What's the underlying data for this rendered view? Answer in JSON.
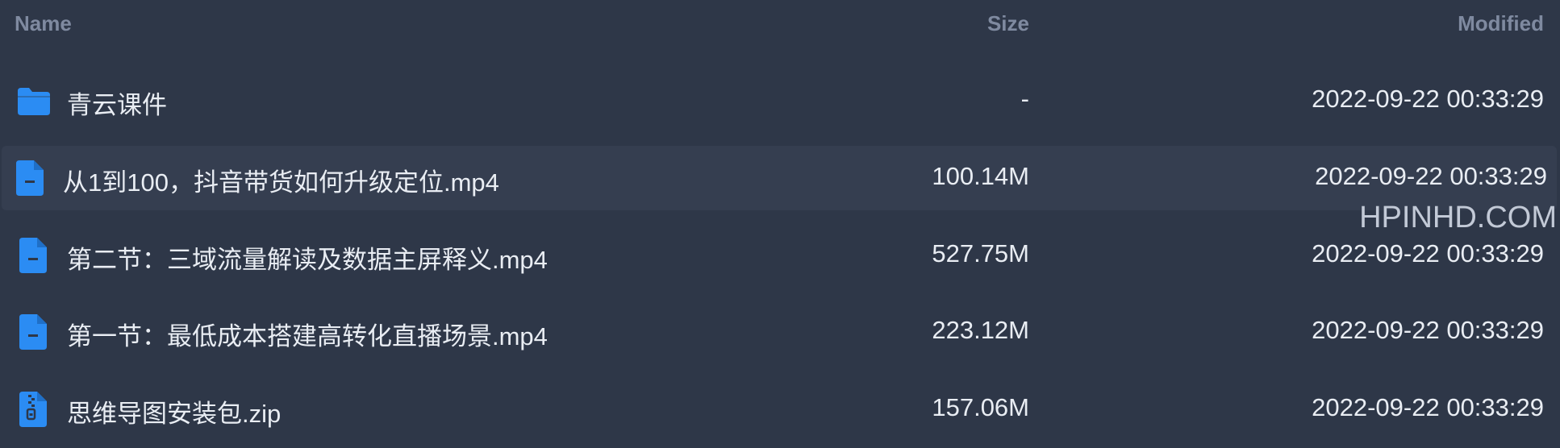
{
  "columns": {
    "name": "Name",
    "size": "Size",
    "modified": "Modified"
  },
  "colors": {
    "background": "#2e3748",
    "row_hover": "#353e50",
    "icon_blue": "#2b8cf3",
    "header_text": "#7f8aa0",
    "text": "#e9edf3"
  },
  "rows": [
    {
      "icon": "folder-icon",
      "name": "青云课件",
      "size": "-",
      "modified": "2022-09-22 00:33:29"
    },
    {
      "icon": "file-icon",
      "name": "从1到100，抖音带货如何升级定位.mp4",
      "size": "100.14M",
      "modified": "2022-09-22 00:33:29"
    },
    {
      "icon": "file-icon",
      "name": "第二节：三域流量解读及数据主屏释义.mp4",
      "size": "527.75M",
      "modified": "2022-09-22 00:33:29"
    },
    {
      "icon": "file-icon",
      "name": "第一节：最低成本搭建高转化直播场景.mp4",
      "size": "223.12M",
      "modified": "2022-09-22 00:33:29"
    },
    {
      "icon": "zip-file-icon",
      "name": "思维导图安装包.zip",
      "size": "157.06M",
      "modified": "2022-09-22 00:33:29"
    }
  ],
  "watermark": "HPINHD.COM"
}
